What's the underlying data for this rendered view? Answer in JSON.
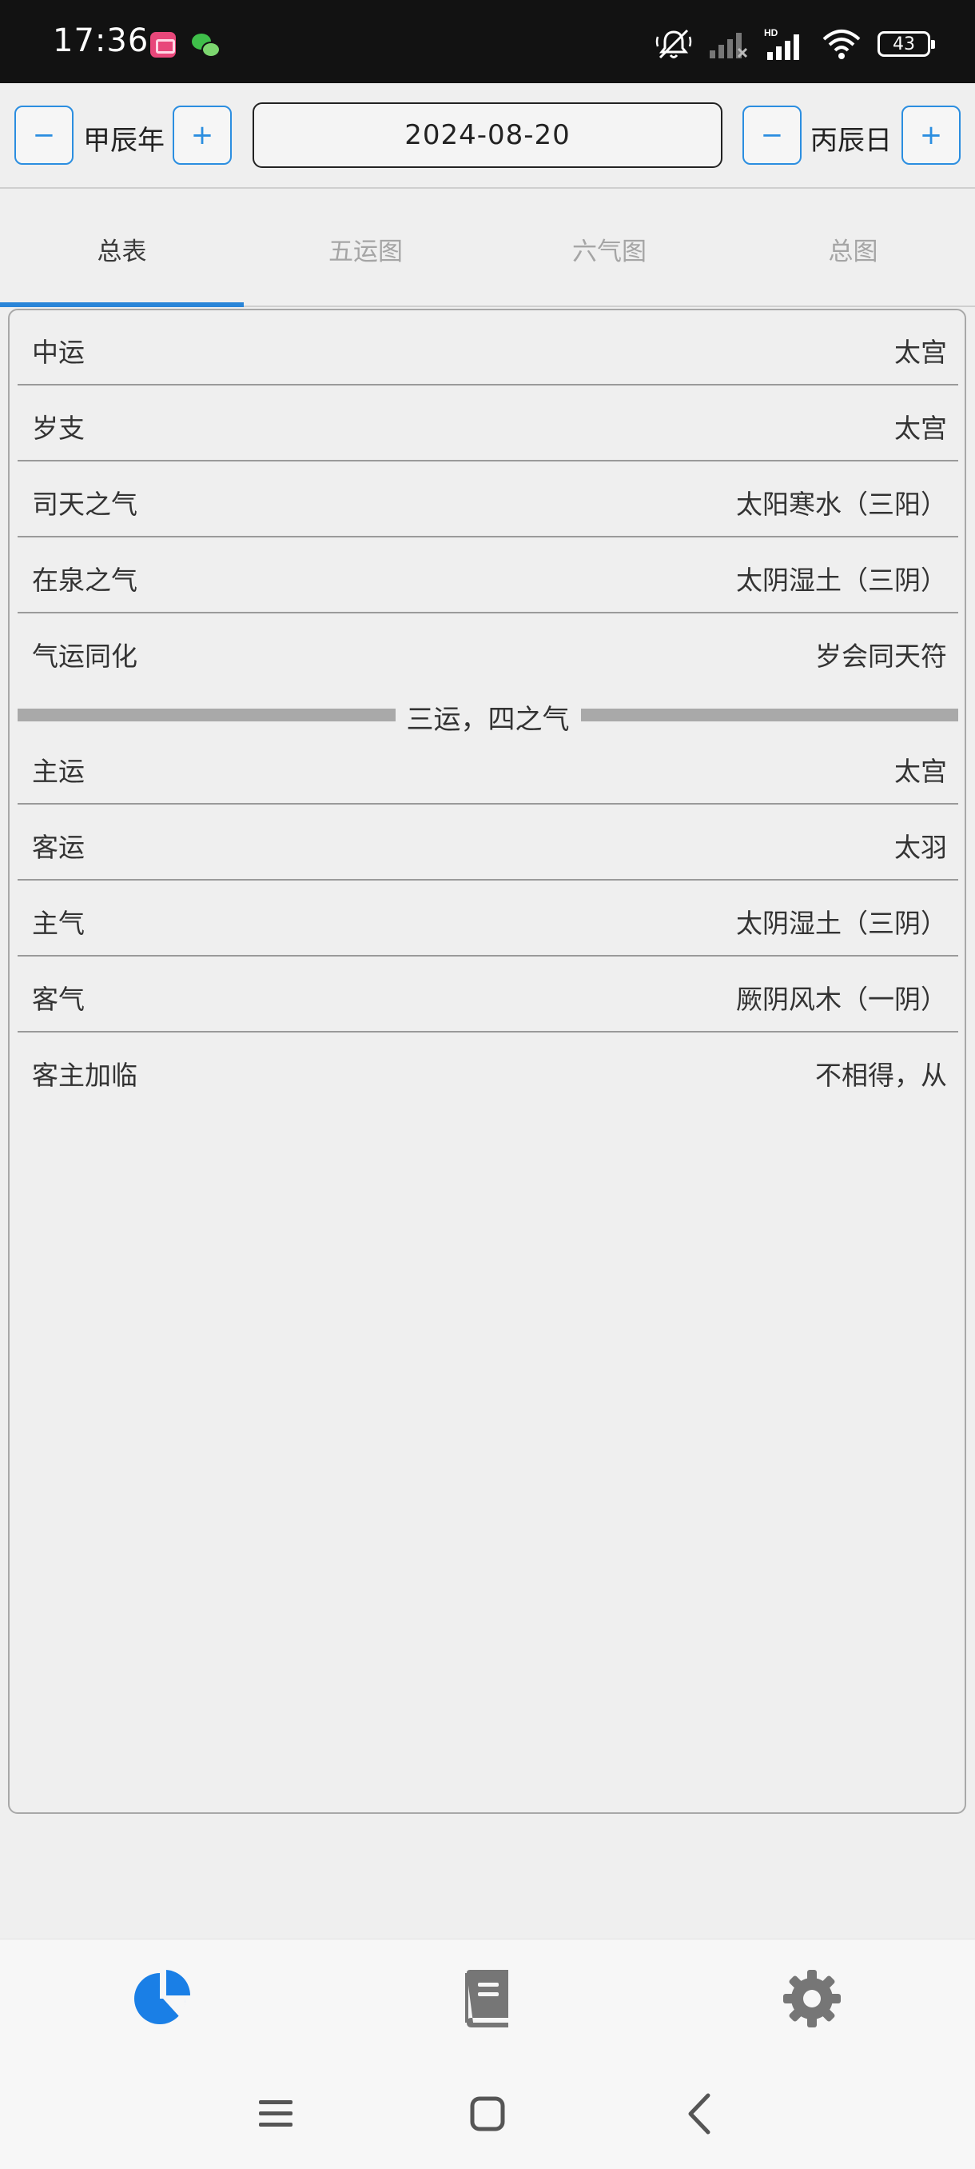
{
  "status_bar": {
    "time": "17:36",
    "battery": "43",
    "icons": [
      "app-notification-icon",
      "wechat-icon",
      "mute-icon",
      "signal-icon",
      "hd-signal-icon",
      "wifi-icon",
      "battery-icon"
    ]
  },
  "date_bar": {
    "year_label": "甲辰年",
    "date": "2024-08-20",
    "day_label": "丙辰日",
    "minus": "−",
    "plus": "+"
  },
  "tabs": [
    {
      "label": "总表",
      "active": true
    },
    {
      "label": "五运图",
      "active": false
    },
    {
      "label": "六气图",
      "active": false
    },
    {
      "label": "总图",
      "active": false
    }
  ],
  "table": {
    "rows_top": [
      {
        "label": "中运",
        "value": "太宫"
      },
      {
        "label": "岁支",
        "value": "太宫"
      },
      {
        "label": "司天之气",
        "value": "太阳寒水（三阳）"
      },
      {
        "label": "在泉之气",
        "value": "太阴湿土（三阴）"
      },
      {
        "label": "气运同化",
        "value": "岁会同天符"
      }
    ],
    "section_title": "三运，四之气",
    "rows_bottom": [
      {
        "label": "主运",
        "value": "太宫"
      },
      {
        "label": "客运",
        "value": "太羽"
      },
      {
        "label": "主气",
        "value": "太阴湿土（三阴）"
      },
      {
        "label": "客气",
        "value": "厥阴风木（一阴）"
      },
      {
        "label": "客主加临",
        "value": "不相得，从"
      }
    ]
  },
  "bottom_nav": {
    "items": [
      "chart-pie-icon",
      "book-icon",
      "gear-icon"
    ],
    "active": "chart-pie-icon",
    "accent_color": "#1a7fe6",
    "inactive_color": "#767676"
  },
  "system_nav": [
    "menu-icon",
    "home-icon",
    "back-icon"
  ]
}
